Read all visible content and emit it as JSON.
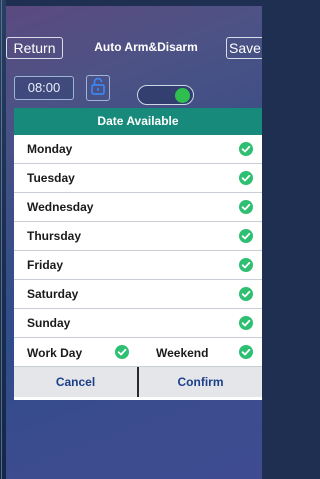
{
  "header": {
    "return_label": "Return",
    "title": "Auto Arm&Disarm",
    "save_label": "Save"
  },
  "controls": {
    "time": "08:00",
    "lock_icon": "lock-open-icon",
    "toggle_on": true
  },
  "dialog": {
    "title": "Date Available",
    "days": [
      {
        "label": "Monday",
        "checked": true
      },
      {
        "label": "Tuesday",
        "checked": true
      },
      {
        "label": "Wednesday",
        "checked": true
      },
      {
        "label": "Thursday",
        "checked": true
      },
      {
        "label": "Friday",
        "checked": true
      },
      {
        "label": "Saturday",
        "checked": true
      },
      {
        "label": "Sunday",
        "checked": true
      }
    ],
    "work_day_label": "Work Day",
    "weekend_label": "Weekend",
    "cancel_label": "Cancel",
    "confirm_label": "Confirm"
  },
  "colors": {
    "accent_teal": "#178a7b",
    "check_green": "#2fbf72",
    "toggle_green": "#2fbf4f",
    "action_blue": "#1c3f8a"
  }
}
